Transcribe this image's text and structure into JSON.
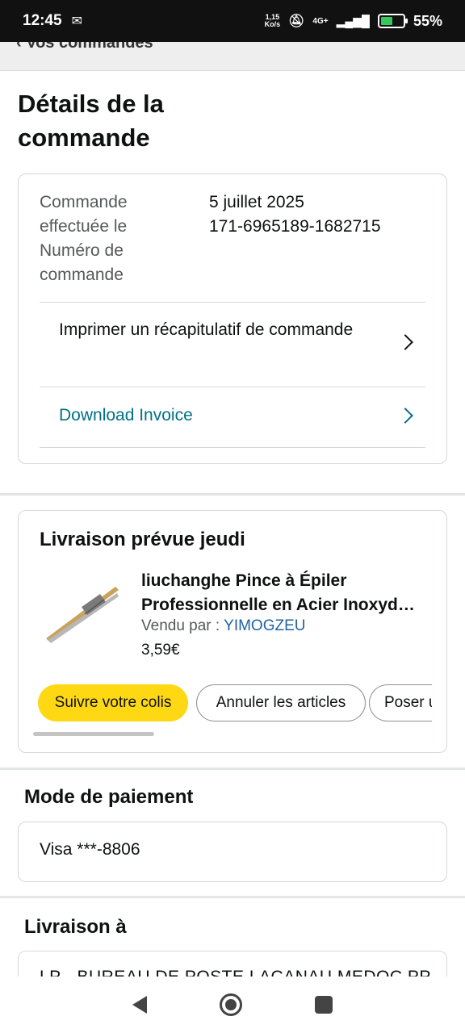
{
  "status": {
    "time": "12:45",
    "speed_top": "1,15",
    "speed_unit": "Ko/s",
    "network": "4G+",
    "battery": "55%",
    "battery_level": 0.55
  },
  "nav": {
    "back_label": "Vos commandes"
  },
  "page": {
    "title": "Détails de la commande"
  },
  "order": {
    "date_label": "Commande effectuée le",
    "date_value": "5 juillet 2025",
    "number_label": "Numéro de commande",
    "number_value": "171-6965189-1682715",
    "print_label": "Imprimer un récapitulatif de commande",
    "invoice_label": "Download Invoice"
  },
  "delivery": {
    "title": "Livraison prévue jeudi",
    "product_name": "liuchanghe Pince à Épiler Professionnelle en Acier Inoxyd…",
    "seller_prefix": "Vendu par  :",
    "seller_name": "YIMOGZEU",
    "price": "3,59€",
    "buttons": {
      "track": "Suivre votre colis",
      "cancel": "Annuler les articles",
      "ask": "Poser u"
    }
  },
  "payment": {
    "title": "Mode de paiement",
    "method": "Visa  ***-8806"
  },
  "shipping": {
    "title": "Livraison à",
    "address": "LP - BUREAU DE POSTE LACANAU MEDOC PP"
  },
  "colors": {
    "accent_link": "#007185",
    "button_yellow": "#ffd814",
    "seller_link": "#2162a1"
  }
}
